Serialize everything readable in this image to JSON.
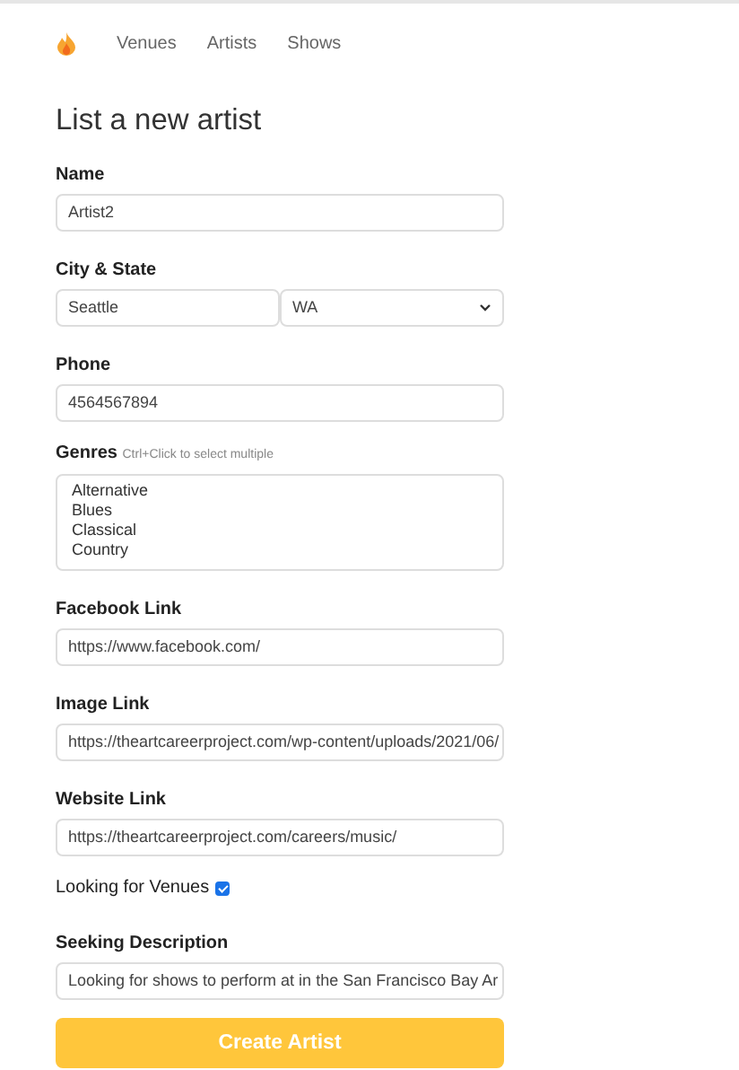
{
  "nav": {
    "links": [
      "Venues",
      "Artists",
      "Shows"
    ]
  },
  "title": "List a new artist",
  "fields": [
    {
      "kind": "text",
      "label": "Name",
      "value": "Artist2"
    },
    {
      "kind": "pair",
      "label": "City & State",
      "value": "Seattle",
      "select_value": "WA"
    },
    {
      "kind": "text",
      "label": "Phone",
      "value": "4564567894"
    },
    {
      "kind": "multiselect",
      "label": "Genres",
      "hint": "Ctrl+Click to select multiple",
      "options": [
        "Alternative",
        "Blues",
        "Classical",
        "Country"
      ]
    },
    {
      "kind": "text",
      "label": "Facebook Link",
      "value": "https://www.facebook.com/"
    },
    {
      "kind": "text",
      "label": "Image Link",
      "value": "https://theartcareerproject.com/wp-content/uploads/2021/06/"
    },
    {
      "kind": "text",
      "label": "Website Link",
      "value": "https://theartcareerproject.com/careers/music/"
    },
    {
      "kind": "checkbox",
      "label": "Looking for Venues",
      "checked": true
    },
    {
      "kind": "text",
      "label": "Seeking Description",
      "value": "Looking for shows to perform at in the San Francisco Bay Ar"
    }
  ],
  "submit": "Create Artist"
}
